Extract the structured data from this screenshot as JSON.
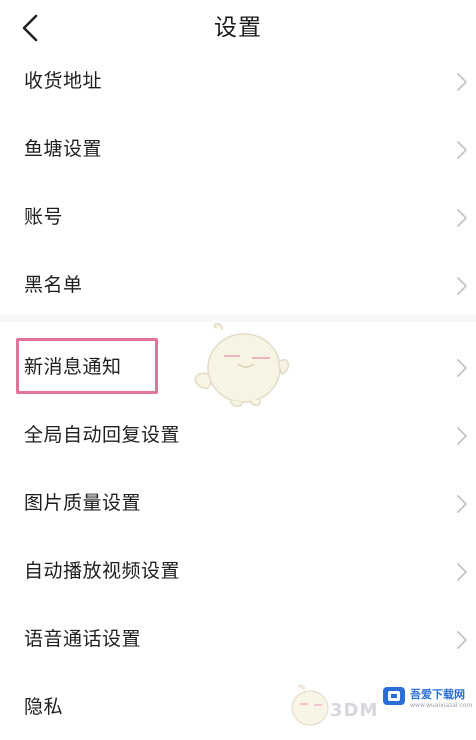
{
  "header": {
    "title": "设置",
    "back_icon": "chevron-left-icon"
  },
  "settings": {
    "group1": [
      {
        "label": "收货地址"
      },
      {
        "label": "鱼塘设置"
      },
      {
        "label": "账号"
      },
      {
        "label": "黑名单"
      }
    ],
    "group2": [
      {
        "label": "新消息通知",
        "highlighted": true
      },
      {
        "label": "全局自动回复设置"
      },
      {
        "label": "图片质量设置"
      },
      {
        "label": "自动播放视频设置"
      },
      {
        "label": "语音通话设置"
      },
      {
        "label": "隐私"
      }
    ],
    "row_icon": "chevron-right-icon"
  },
  "overlay": {
    "highlight_color": "#e2739d",
    "watermark_text": "3DM",
    "site_name": "吾爱下载网",
    "site_url": "www.wuaixiazai.com"
  }
}
